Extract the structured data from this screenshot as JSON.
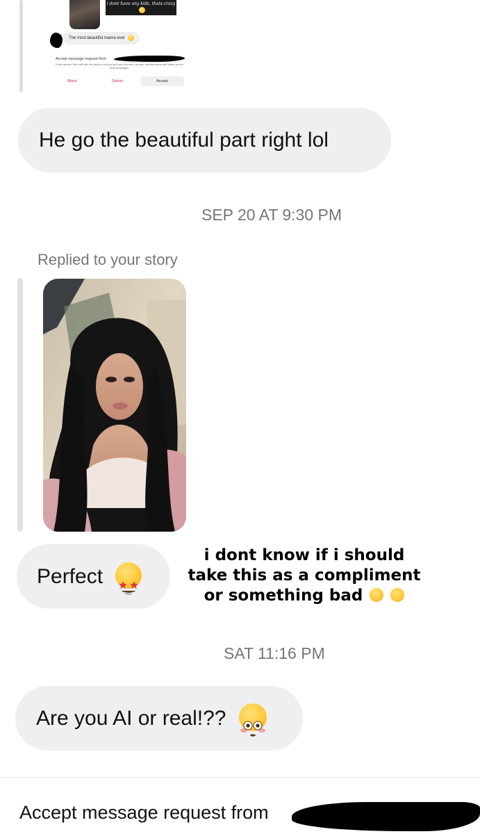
{
  "nested_screenshot": {
    "dark_bubble_text": "i dont have any kids, thats crazy",
    "message": "The most beautiful mama ever",
    "accept_title": "Accept message request from",
    "accept_subtitle": "If you accept, they will also be able to call you and see info such as your activity status and when you've read messages.",
    "block_label": "Block",
    "delete_label": "Delete",
    "accept_label": "Accept"
  },
  "messages": [
    {
      "text": "He go the beautiful part right lol"
    },
    {
      "text": "Perfect",
      "emoji": "star-struck-icon"
    },
    {
      "text": "Are you AI or real!??",
      "emoji": "flushed-face-icon"
    }
  ],
  "timestamps": [
    "SEP 20 AT 9:30 PM",
    "SAT 11:16 PM"
  ],
  "story_reply_label": "Replied to your story",
  "overlay_caption": "i dont know if i should take this as a compliment or something bad",
  "overlay_emojis": [
    "loudly-crying-face-icon",
    "tears-of-joy-icon"
  ],
  "bottom_banner": {
    "text": "Accept message request from"
  },
  "colors": {
    "bubble_bg": "#efeff1",
    "timestamp": "#767676",
    "danger": "#e0245e",
    "redaction": "#000000"
  }
}
